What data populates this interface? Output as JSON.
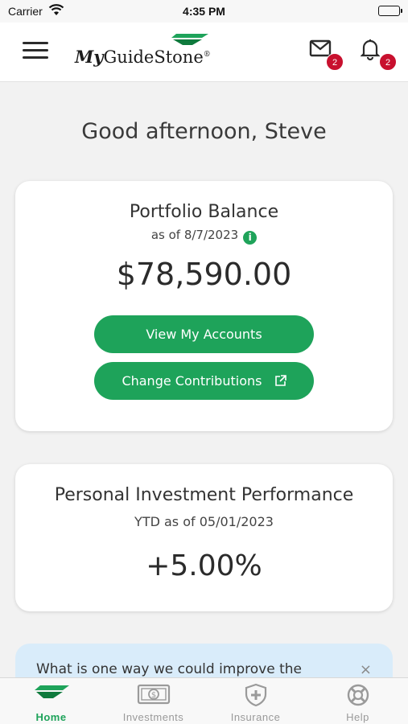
{
  "status_bar": {
    "carrier": "Carrier",
    "time": "4:35 PM"
  },
  "header": {
    "logo_my": "My",
    "logo_rest": "GuideStone",
    "logo_mark": "®",
    "mail_count": "2",
    "notification_count": "2"
  },
  "greeting": "Good afternoon, Steve",
  "portfolio": {
    "title": "Portfolio Balance",
    "as_of": "as of 8/7/2023",
    "info_icon": "i",
    "balance": "$78,590.00",
    "view_accounts_label": "View My Accounts",
    "change_contributions_label": "Change Contributions"
  },
  "performance": {
    "title": "Personal Investment Performance",
    "subtitle": "YTD as of 05/01/2023",
    "value": "+5.00%"
  },
  "feedback": {
    "text": "What is one way we could improve the",
    "close": "×"
  },
  "tabs": [
    {
      "label": "Home",
      "icon": "guidestone-logo-icon",
      "active": true
    },
    {
      "label": "Investments",
      "icon": "money-icon",
      "active": false
    },
    {
      "label": "Insurance",
      "icon": "shield-plus-icon",
      "active": false
    },
    {
      "label": "Help",
      "icon": "lifebuoy-icon",
      "active": false
    }
  ],
  "colors": {
    "accent": "#1ea35a",
    "badge": "#c8102e",
    "banner": "#d9ecfa"
  }
}
